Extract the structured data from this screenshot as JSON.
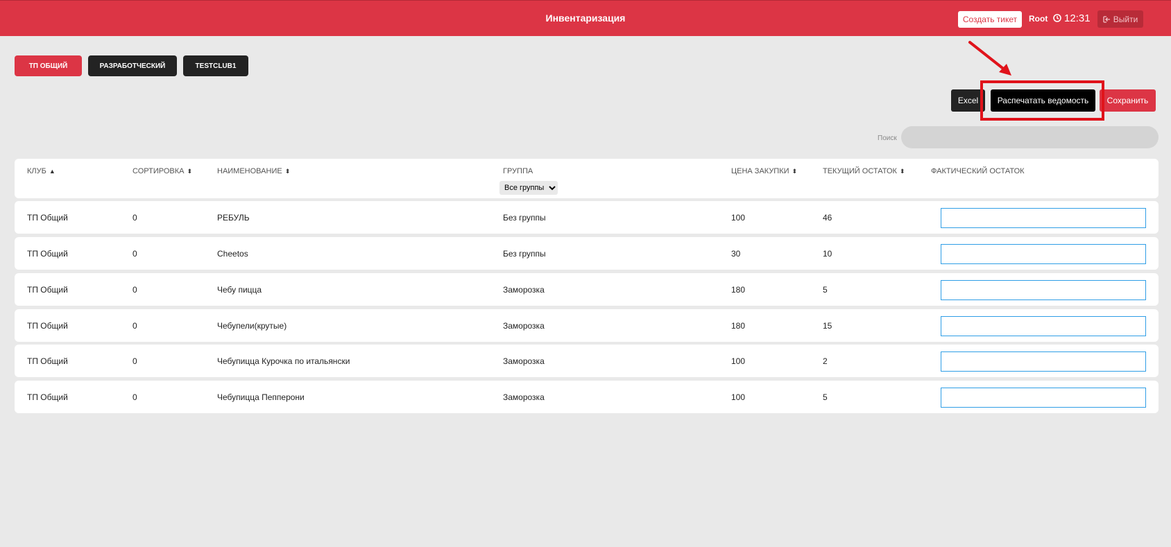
{
  "header": {
    "title": "Инвентаризация",
    "create_ticket": "Создать тикет",
    "user": "Root",
    "time": "12:31",
    "logout": "Выйти",
    "brand_color": "#dc3545"
  },
  "tabs": [
    {
      "label": "ТП ОБЩИЙ",
      "active": true
    },
    {
      "label": "РАЗРАБОТЧЕСКИЙ",
      "active": false
    },
    {
      "label": "TESTCLUB1",
      "active": false
    }
  ],
  "actions": {
    "excel": "Excel",
    "print": "Распечатать ведомость",
    "save": "Сохранить"
  },
  "search": {
    "label": "Поиск",
    "value": ""
  },
  "table": {
    "headers": {
      "club": "КЛУБ",
      "sort": "СОРТИРОВКА",
      "name": "НАИМЕНОВАНИЕ",
      "group": "ГРУППА",
      "price": "ЦЕНА ЗАКУПКИ",
      "stock": "ТЕКУЩИЙ ОСТАТОК",
      "actual": "ФАКТИЧЕСКИЙ ОСТАТОК"
    },
    "group_filter": "Все группы",
    "rows": [
      {
        "club": "ТП Общий",
        "sort": "0",
        "name": "РЕБУЛЬ",
        "group": "Без группы",
        "price": "100",
        "stock": "46",
        "actual": ""
      },
      {
        "club": "ТП Общий",
        "sort": "0",
        "name": "Cheetos",
        "group": "Без группы",
        "price": "30",
        "stock": "10",
        "actual": ""
      },
      {
        "club": "ТП Общий",
        "sort": "0",
        "name": "Чебу пицца",
        "group": "Заморозка",
        "price": "180",
        "stock": "5",
        "actual": ""
      },
      {
        "club": "ТП Общий",
        "sort": "0",
        "name": "Чебупели(крутые)",
        "group": "Заморозка",
        "price": "180",
        "stock": "15",
        "actual": ""
      },
      {
        "club": "ТП Общий",
        "sort": "0",
        "name": "Чебупицца Курочка по итальянски",
        "group": "Заморозка",
        "price": "100",
        "stock": "2",
        "actual": ""
      },
      {
        "club": "ТП Общий",
        "sort": "0",
        "name": "Чебупицца Пепперони",
        "group": "Заморозка",
        "price": "100",
        "stock": "5",
        "actual": ""
      }
    ]
  }
}
